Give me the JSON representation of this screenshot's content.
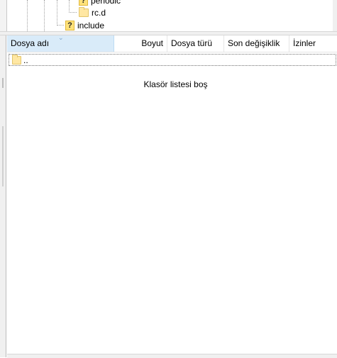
{
  "tree": {
    "nodes": [
      {
        "label": "periodic",
        "icon": "unknown-folder-icon"
      },
      {
        "label": "rc.d",
        "icon": "folder-icon"
      },
      {
        "label": "include",
        "icon": "unknown-folder-icon"
      }
    ]
  },
  "file_list": {
    "columns": [
      "Dosya adı",
      "Boyut",
      "Dosya türü",
      "Son değişiklik",
      "İzinler"
    ],
    "sorted_column": "Dosya adı",
    "rows": [
      {
        "name": ".."
      }
    ],
    "empty_message": "Klasör listesi boş"
  },
  "colors": {
    "selected_header": "#d9ebf9",
    "folder": "#ffe7a3",
    "unknown_icon": "#ffe27a"
  }
}
